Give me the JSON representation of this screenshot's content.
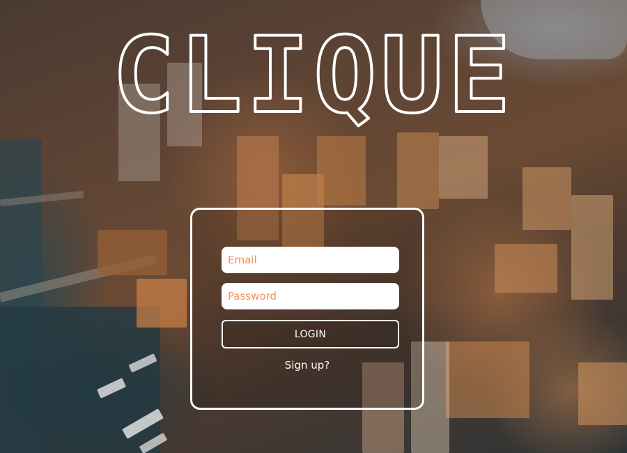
{
  "app": {
    "title": "CLIQUE"
  },
  "login": {
    "email_placeholder": "Email",
    "password_placeholder": "Password",
    "login_label": "LOGIN",
    "signup_label": "Sign up?"
  },
  "colors": {
    "placeholder": "#f0925a",
    "card_border": "#ffffff",
    "title_outline": "#ffffff"
  }
}
